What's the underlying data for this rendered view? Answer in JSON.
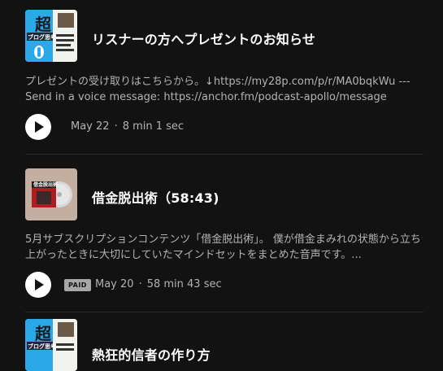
{
  "episodes": [
    {
      "title": "リスナーの方へプレゼントのお知らせ",
      "description": "プレゼントの受け取りはこちらから。↓https://my28p.com/p/r/MA0bqkWu --- Send in a voice message: https://anchor.fm/podcast-apollo/message",
      "date": "May 22",
      "duration": "8 min 1 sec",
      "paid": false,
      "thumb_kanji": "超",
      "thumb_label": "ブログ思考"
    },
    {
      "title": "借金脱出術（58:43)",
      "description": "5月サブスクリプションコンテンツ「借金脱出術」。 僕が借金まみれの状態から立ち上がったときに大切にしていたマインドセットをまとめた音声です。...",
      "date": "May 20",
      "duration": "58 min 43 sec",
      "paid": true,
      "paid_label": "PAID",
      "thumb_label": "借金脱出術"
    },
    {
      "title": "熱狂的信者の作り方",
      "thumb_kanji": "超",
      "thumb_label": "ブログ思考"
    }
  ],
  "separator": "·",
  "colors": {
    "background": "#121212",
    "text_primary": "#ffffff",
    "text_secondary": "#b3b3b3",
    "play_button": "#ffffff",
    "paid_badge": "#a7a7a7"
  },
  "icons": {
    "play": "play-icon"
  }
}
